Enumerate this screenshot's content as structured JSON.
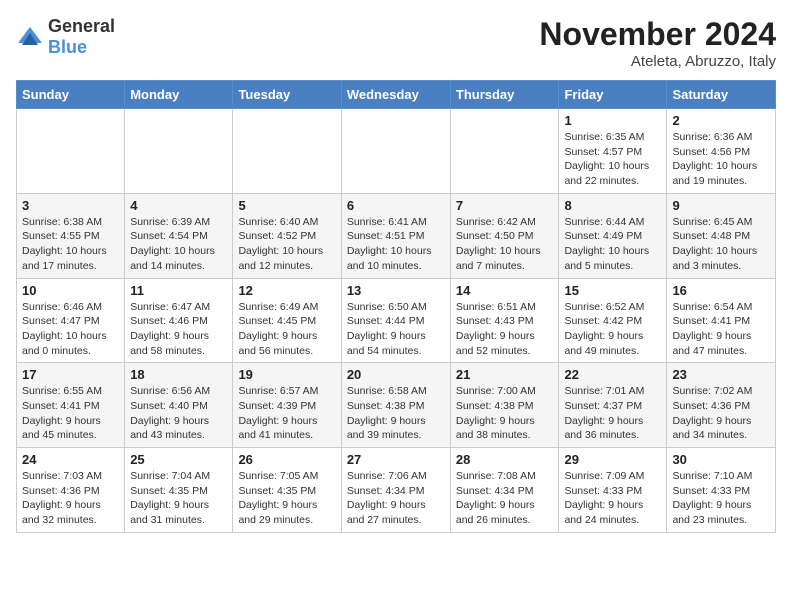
{
  "header": {
    "logo_general": "General",
    "logo_blue": "Blue",
    "month": "November 2024",
    "location": "Ateleta, Abruzzo, Italy"
  },
  "weekdays": [
    "Sunday",
    "Monday",
    "Tuesday",
    "Wednesday",
    "Thursday",
    "Friday",
    "Saturday"
  ],
  "weeks": [
    [
      {
        "day": "",
        "info": ""
      },
      {
        "day": "",
        "info": ""
      },
      {
        "day": "",
        "info": ""
      },
      {
        "day": "",
        "info": ""
      },
      {
        "day": "",
        "info": ""
      },
      {
        "day": "1",
        "info": "Sunrise: 6:35 AM\nSunset: 4:57 PM\nDaylight: 10 hours and 22 minutes."
      },
      {
        "day": "2",
        "info": "Sunrise: 6:36 AM\nSunset: 4:56 PM\nDaylight: 10 hours and 19 minutes."
      }
    ],
    [
      {
        "day": "3",
        "info": "Sunrise: 6:38 AM\nSunset: 4:55 PM\nDaylight: 10 hours and 17 minutes."
      },
      {
        "day": "4",
        "info": "Sunrise: 6:39 AM\nSunset: 4:54 PM\nDaylight: 10 hours and 14 minutes."
      },
      {
        "day": "5",
        "info": "Sunrise: 6:40 AM\nSunset: 4:52 PM\nDaylight: 10 hours and 12 minutes."
      },
      {
        "day": "6",
        "info": "Sunrise: 6:41 AM\nSunset: 4:51 PM\nDaylight: 10 hours and 10 minutes."
      },
      {
        "day": "7",
        "info": "Sunrise: 6:42 AM\nSunset: 4:50 PM\nDaylight: 10 hours and 7 minutes."
      },
      {
        "day": "8",
        "info": "Sunrise: 6:44 AM\nSunset: 4:49 PM\nDaylight: 10 hours and 5 minutes."
      },
      {
        "day": "9",
        "info": "Sunrise: 6:45 AM\nSunset: 4:48 PM\nDaylight: 10 hours and 3 minutes."
      }
    ],
    [
      {
        "day": "10",
        "info": "Sunrise: 6:46 AM\nSunset: 4:47 PM\nDaylight: 10 hours and 0 minutes."
      },
      {
        "day": "11",
        "info": "Sunrise: 6:47 AM\nSunset: 4:46 PM\nDaylight: 9 hours and 58 minutes."
      },
      {
        "day": "12",
        "info": "Sunrise: 6:49 AM\nSunset: 4:45 PM\nDaylight: 9 hours and 56 minutes."
      },
      {
        "day": "13",
        "info": "Sunrise: 6:50 AM\nSunset: 4:44 PM\nDaylight: 9 hours and 54 minutes."
      },
      {
        "day": "14",
        "info": "Sunrise: 6:51 AM\nSunset: 4:43 PM\nDaylight: 9 hours and 52 minutes."
      },
      {
        "day": "15",
        "info": "Sunrise: 6:52 AM\nSunset: 4:42 PM\nDaylight: 9 hours and 49 minutes."
      },
      {
        "day": "16",
        "info": "Sunrise: 6:54 AM\nSunset: 4:41 PM\nDaylight: 9 hours and 47 minutes."
      }
    ],
    [
      {
        "day": "17",
        "info": "Sunrise: 6:55 AM\nSunset: 4:41 PM\nDaylight: 9 hours and 45 minutes."
      },
      {
        "day": "18",
        "info": "Sunrise: 6:56 AM\nSunset: 4:40 PM\nDaylight: 9 hours and 43 minutes."
      },
      {
        "day": "19",
        "info": "Sunrise: 6:57 AM\nSunset: 4:39 PM\nDaylight: 9 hours and 41 minutes."
      },
      {
        "day": "20",
        "info": "Sunrise: 6:58 AM\nSunset: 4:38 PM\nDaylight: 9 hours and 39 minutes."
      },
      {
        "day": "21",
        "info": "Sunrise: 7:00 AM\nSunset: 4:38 PM\nDaylight: 9 hours and 38 minutes."
      },
      {
        "day": "22",
        "info": "Sunrise: 7:01 AM\nSunset: 4:37 PM\nDaylight: 9 hours and 36 minutes."
      },
      {
        "day": "23",
        "info": "Sunrise: 7:02 AM\nSunset: 4:36 PM\nDaylight: 9 hours and 34 minutes."
      }
    ],
    [
      {
        "day": "24",
        "info": "Sunrise: 7:03 AM\nSunset: 4:36 PM\nDaylight: 9 hours and 32 minutes."
      },
      {
        "day": "25",
        "info": "Sunrise: 7:04 AM\nSunset: 4:35 PM\nDaylight: 9 hours and 31 minutes."
      },
      {
        "day": "26",
        "info": "Sunrise: 7:05 AM\nSunset: 4:35 PM\nDaylight: 9 hours and 29 minutes."
      },
      {
        "day": "27",
        "info": "Sunrise: 7:06 AM\nSunset: 4:34 PM\nDaylight: 9 hours and 27 minutes."
      },
      {
        "day": "28",
        "info": "Sunrise: 7:08 AM\nSunset: 4:34 PM\nDaylight: 9 hours and 26 minutes."
      },
      {
        "day": "29",
        "info": "Sunrise: 7:09 AM\nSunset: 4:33 PM\nDaylight: 9 hours and 24 minutes."
      },
      {
        "day": "30",
        "info": "Sunrise: 7:10 AM\nSunset: 4:33 PM\nDaylight: 9 hours and 23 minutes."
      }
    ]
  ]
}
